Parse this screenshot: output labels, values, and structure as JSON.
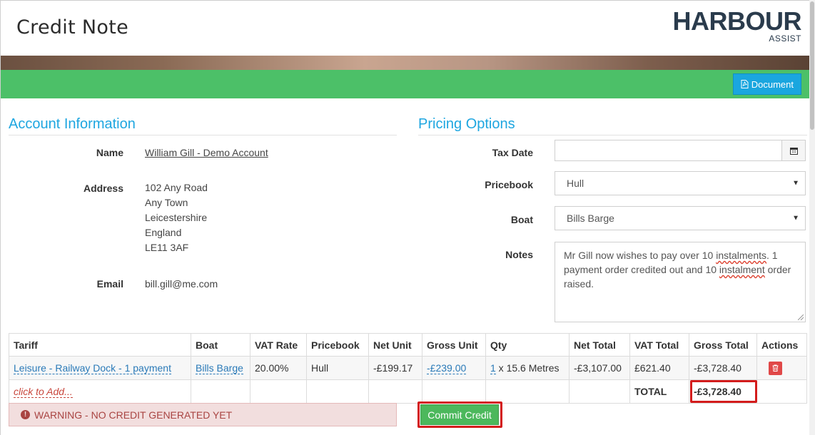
{
  "header": {
    "title": "Credit Note",
    "logo_main": "HARBOUR",
    "logo_sub": "ASSIST"
  },
  "toolbar": {
    "document_label": "Document",
    "document_icon": "pdf-file-icon"
  },
  "account": {
    "section_title": "Account Information",
    "name_label": "Name",
    "name_value": "William Gill - Demo Account",
    "address_label": "Address",
    "address_lines": [
      "102 Any Road",
      "Any Town",
      "Leicestershire",
      "England",
      "LE11 3AF"
    ],
    "email_label": "Email",
    "email_value": "bill.gill@me.com"
  },
  "pricing": {
    "section_title": "Pricing Options",
    "tax_date_label": "Tax Date",
    "tax_date_value": "",
    "pricebook_label": "Pricebook",
    "pricebook_value": "Hull",
    "boat_label": "Boat",
    "boat_value": "Bills Barge",
    "notes_label": "Notes",
    "notes_parts": [
      "Mr Gill now wishes to pay over 10 ",
      "instalments",
      ".  1 payment order credited out and 10 ",
      "instalment",
      " order raised."
    ]
  },
  "table": {
    "headers": [
      "Tariff",
      "Boat",
      "VAT Rate",
      "Pricebook",
      "Net Unit",
      "Gross Unit",
      "Qty",
      "Net Total",
      "VAT Total",
      "Gross Total",
      "Actions"
    ],
    "row": {
      "tariff": "Leisure - Railway Dock - 1 payment",
      "boat": "Bills Barge",
      "vat_rate": "20.00%",
      "pricebook": "Hull",
      "net_unit": "-£199.17",
      "gross_unit": "-£239.00",
      "qty_value": "1",
      "qty_unit": " x 15.6 Metres",
      "net_total": "-£3,107.00",
      "vat_total": "£621.40",
      "gross_total": "-£3,728.40"
    },
    "add_label": "click to Add...",
    "total_label": "TOTAL",
    "total_value": "-£3,728.40"
  },
  "footer": {
    "warning": "WARNING - NO CREDIT GENERATED YET",
    "commit_label": "Commit Credit"
  },
  "colors": {
    "accent": "#1ea6e0",
    "green": "#4cc068",
    "danger": "#e04848",
    "highlight": "#d31c1c"
  }
}
